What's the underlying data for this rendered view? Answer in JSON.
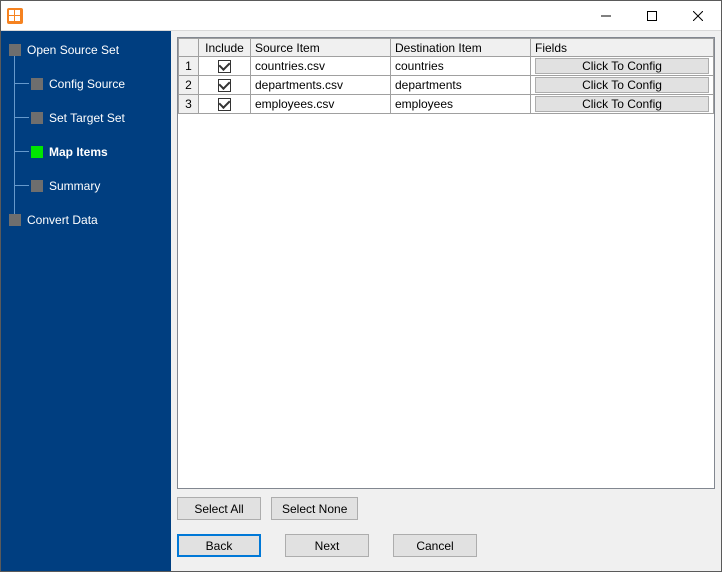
{
  "titlebar": {
    "min_tip": "Minimize",
    "max_tip": "Maximize",
    "close_tip": "Close"
  },
  "sidebar": {
    "root1": "Open Source Set",
    "children": [
      "Config Source",
      "Set Target Set",
      "Map Items",
      "Summary"
    ],
    "root2": "Convert Data",
    "current_index": 2
  },
  "grid": {
    "headers": {
      "include": "Include",
      "source": "Source Item",
      "dest": "Destination Item",
      "fields": "Fields"
    },
    "rows": [
      {
        "n": "1",
        "include": true,
        "source": "countries.csv",
        "dest": "countries",
        "btn": "Click To Config"
      },
      {
        "n": "2",
        "include": true,
        "source": "departments.csv",
        "dest": "departments",
        "btn": "Click To Config"
      },
      {
        "n": "3",
        "include": true,
        "source": "employees.csv",
        "dest": "employees",
        "btn": "Click To Config"
      }
    ]
  },
  "buttons": {
    "select_all": "Select All",
    "select_none": "Select None",
    "back": "Back",
    "next": "Next",
    "cancel": "Cancel"
  }
}
